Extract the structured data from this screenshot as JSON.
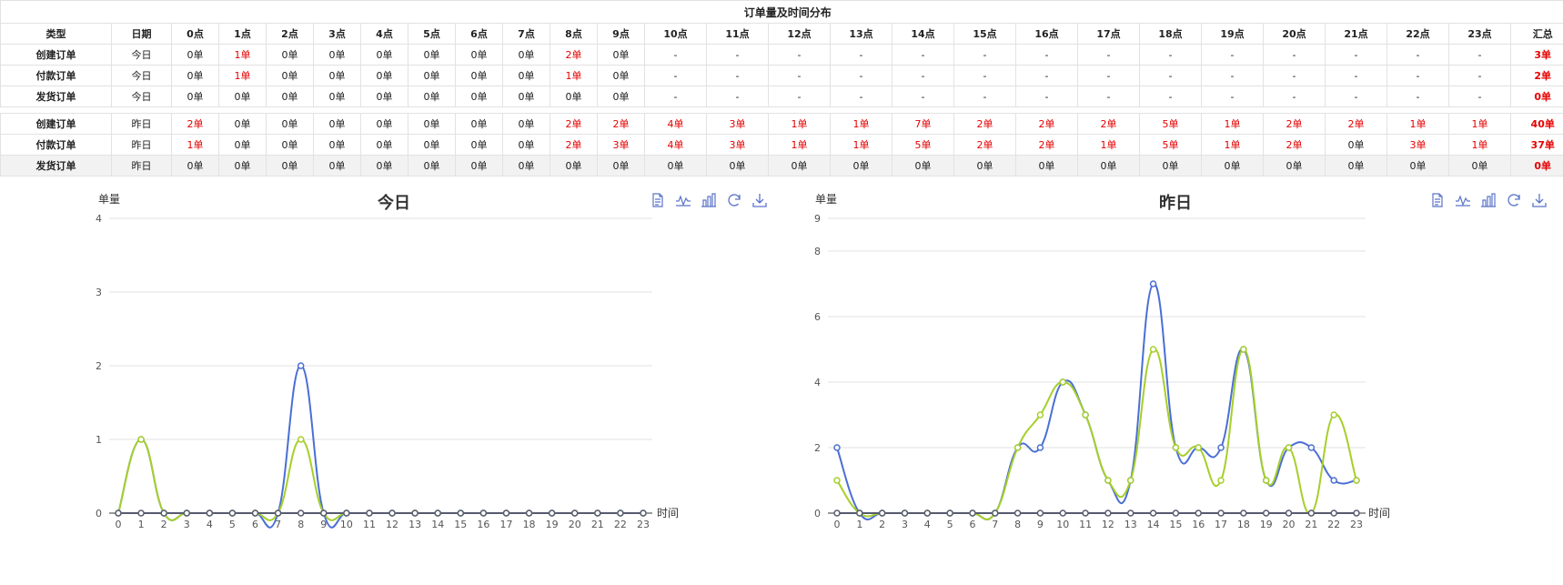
{
  "table": {
    "title": "订单量及时间分布",
    "header": [
      "类型",
      "日期",
      "0点",
      "1点",
      "2点",
      "3点",
      "4点",
      "5点",
      "6点",
      "7点",
      "8点",
      "9点",
      "10点",
      "11点",
      "12点",
      "13点",
      "14点",
      "15点",
      "16点",
      "17点",
      "18点",
      "19点",
      "20点",
      "21点",
      "22点",
      "23点",
      "汇总"
    ],
    "today_rows": [
      {
        "type": "创建订单",
        "date": "今日",
        "cells": [
          "0单",
          "1单",
          "0单",
          "0单",
          "0单",
          "0单",
          "0单",
          "0单",
          "2单",
          "0单",
          "-",
          "-",
          "-",
          "-",
          "-",
          "-",
          "-",
          "-",
          "-",
          "-",
          "-",
          "-",
          "-",
          "-"
        ],
        "total": "3单"
      },
      {
        "type": "付款订单",
        "date": "今日",
        "cells": [
          "0单",
          "1单",
          "0单",
          "0单",
          "0单",
          "0单",
          "0单",
          "0单",
          "1单",
          "0单",
          "-",
          "-",
          "-",
          "-",
          "-",
          "-",
          "-",
          "-",
          "-",
          "-",
          "-",
          "-",
          "-",
          "-"
        ],
        "total": "2单"
      },
      {
        "type": "发货订单",
        "date": "今日",
        "cells": [
          "0单",
          "0单",
          "0单",
          "0单",
          "0单",
          "0单",
          "0单",
          "0单",
          "0单",
          "0单",
          "-",
          "-",
          "-",
          "-",
          "-",
          "-",
          "-",
          "-",
          "-",
          "-",
          "-",
          "-",
          "-",
          "-"
        ],
        "total": "0单"
      }
    ],
    "yesterday_rows": [
      {
        "type": "创建订单",
        "date": "昨日",
        "cells": [
          "2单",
          "0单",
          "0单",
          "0单",
          "0单",
          "0单",
          "0单",
          "0单",
          "2单",
          "2单",
          "4单",
          "3单",
          "1单",
          "1单",
          "7单",
          "2单",
          "2单",
          "2单",
          "5单",
          "1单",
          "2单",
          "2单",
          "1单",
          "1单"
        ],
        "total": "40单"
      },
      {
        "type": "付款订单",
        "date": "昨日",
        "cells": [
          "1单",
          "0单",
          "0单",
          "0单",
          "0单",
          "0单",
          "0单",
          "0单",
          "2单",
          "3单",
          "4单",
          "3单",
          "1单",
          "1单",
          "5单",
          "2单",
          "2单",
          "1单",
          "5单",
          "1单",
          "2单",
          "0单",
          "3单",
          "1单"
        ],
        "total": "37单"
      },
      {
        "type": "发货订单",
        "date": "昨日",
        "cells": [
          "0单",
          "0单",
          "0单",
          "0单",
          "0单",
          "0单",
          "0单",
          "0单",
          "0单",
          "0单",
          "0单",
          "0单",
          "0单",
          "0单",
          "0单",
          "0单",
          "0单",
          "0单",
          "0单",
          "0单",
          "0单",
          "0单",
          "0单",
          "0单"
        ],
        "total": "0单"
      }
    ]
  },
  "colors": {
    "created": "#4a6fd4",
    "paid": "#a6cf2a",
    "shipped": "#555a6e",
    "red": "#e60000",
    "grid": "#e0e0e0",
    "axis": "#333333"
  },
  "toolbar_icons": [
    "data-view-icon",
    "line-chart-icon",
    "bar-chart-icon",
    "refresh-icon",
    "download-icon"
  ],
  "chart_data": [
    {
      "type": "line",
      "title": "今日",
      "xlabel": "时间",
      "ylabel": "单量",
      "x": [
        0,
        1,
        2,
        3,
        4,
        5,
        6,
        7,
        8,
        9,
        10,
        11,
        12,
        13,
        14,
        15,
        16,
        17,
        18,
        19,
        20,
        21,
        22,
        23
      ],
      "ylim": [
        0,
        4
      ],
      "yticks": [
        0,
        1,
        2,
        3,
        4
      ],
      "series": [
        {
          "values": [
            0,
            1,
            0,
            0,
            0,
            0,
            0,
            0,
            2,
            0,
            0,
            0,
            0,
            0,
            0,
            0,
            0,
            0,
            0,
            0,
            0,
            0,
            0,
            0
          ]
        },
        {
          "values": [
            0,
            1,
            0,
            0,
            0,
            0,
            0,
            0,
            1,
            0,
            0,
            0,
            0,
            0,
            0,
            0,
            0,
            0,
            0,
            0,
            0,
            0,
            0,
            0
          ]
        },
        {
          "values": [
            0,
            0,
            0,
            0,
            0,
            0,
            0,
            0,
            0,
            0,
            0,
            0,
            0,
            0,
            0,
            0,
            0,
            0,
            0,
            0,
            0,
            0,
            0,
            0
          ]
        }
      ]
    },
    {
      "type": "line",
      "title": "昨日",
      "xlabel": "时间",
      "ylabel": "单量",
      "x": [
        0,
        1,
        2,
        3,
        4,
        5,
        6,
        7,
        8,
        9,
        10,
        11,
        12,
        13,
        14,
        15,
        16,
        17,
        18,
        19,
        20,
        21,
        22,
        23
      ],
      "ylim": [
        0,
        9
      ],
      "yticks": [
        0,
        2,
        4,
        6,
        8,
        9
      ],
      "series": [
        {
          "values": [
            2,
            0,
            0,
            0,
            0,
            0,
            0,
            0,
            2,
            2,
            4,
            3,
            1,
            1,
            7,
            2,
            2,
            2,
            5,
            1,
            2,
            2,
            1,
            1
          ]
        },
        {
          "values": [
            1,
            0,
            0,
            0,
            0,
            0,
            0,
            0,
            2,
            3,
            4,
            3,
            1,
            1,
            5,
            2,
            2,
            1,
            5,
            1,
            2,
            0,
            3,
            1
          ]
        },
        {
          "values": [
            0,
            0,
            0,
            0,
            0,
            0,
            0,
            0,
            0,
            0,
            0,
            0,
            0,
            0,
            0,
            0,
            0,
            0,
            0,
            0,
            0,
            0,
            0,
            0
          ]
        }
      ]
    }
  ]
}
